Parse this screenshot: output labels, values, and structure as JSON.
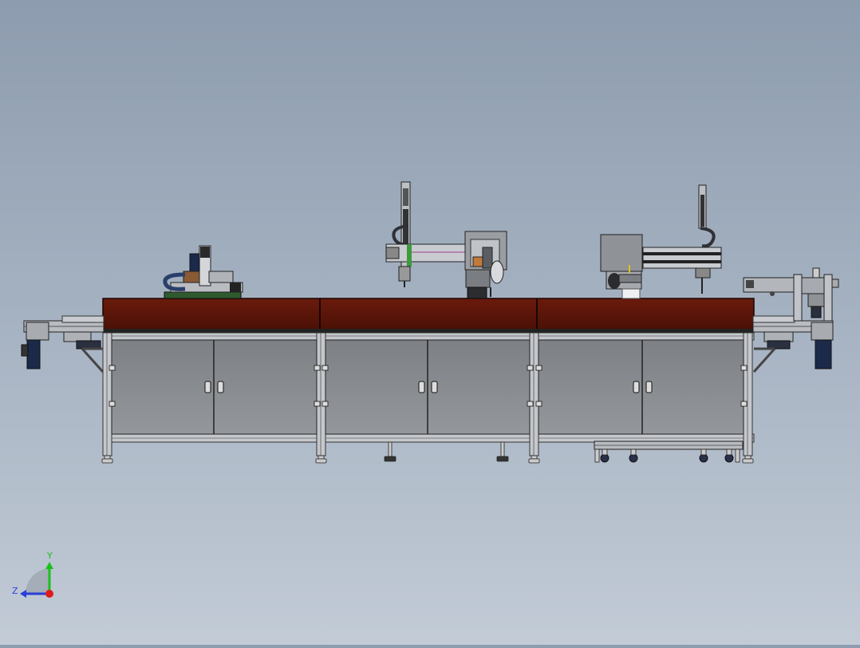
{
  "view": {
    "background_top": "#8d9cae",
    "background_bottom": "#c2cbd6"
  },
  "machine": {
    "worktop_color": "#5a1508",
    "cabinet_color": "#888a8e",
    "frame_color": "#c4c7cc",
    "motor_color": "#1c2a4a",
    "cable_color": "#2a3f6a",
    "sections": 3,
    "doors_per_section": 2
  },
  "triad": {
    "y_label": "Y",
    "z_label": "Z",
    "y_color": "#19c219",
    "z_color": "#2a3fd6",
    "x_color": "#e01a1a"
  }
}
